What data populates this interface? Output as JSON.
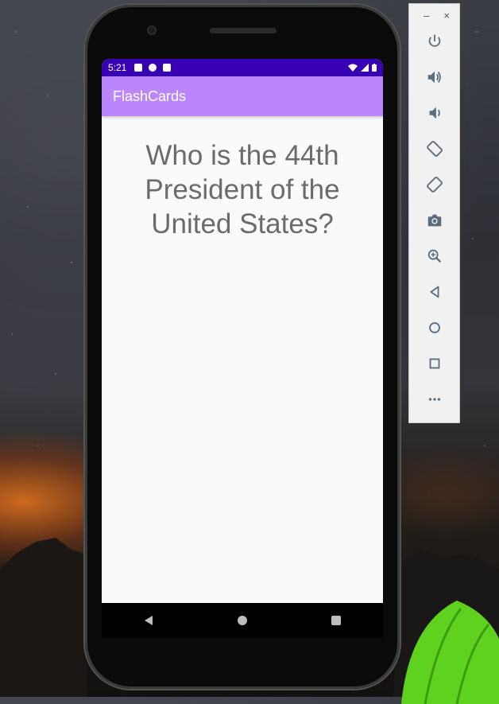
{
  "window_controls": {
    "minimize": "–",
    "close": "×"
  },
  "device": {
    "status_bar": {
      "time": "5:21"
    },
    "app_bar": {
      "title": "FlashCards"
    },
    "card": {
      "question": "Who is the 44th President of the United States?"
    }
  },
  "emulator_panel": {
    "buttons": [
      "power-icon",
      "volume-up-icon",
      "volume-down-icon",
      "rotate-left-icon",
      "rotate-right-icon",
      "camera-icon",
      "zoom-icon",
      "back-icon",
      "home-icon",
      "overview-icon",
      "more-icon"
    ]
  },
  "colors": {
    "status_bar": "#3700b3",
    "app_bar": "#bb86fc",
    "question_text": "#6b6b6b",
    "screen_bg": "#fafafa"
  }
}
